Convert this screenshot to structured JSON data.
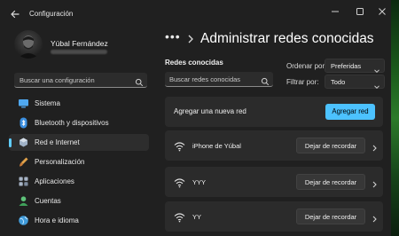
{
  "window": {
    "title": "Configuración"
  },
  "user": {
    "name": "Yúbal Fernández"
  },
  "sidebar": {
    "search_placeholder": "Buscar una configuración",
    "items": [
      {
        "label": "Sistema",
        "icon": "monitor-icon",
        "color": "#4fa8f0"
      },
      {
        "label": "Bluetooth y dispositivos",
        "icon": "bluetooth-icon",
        "color": "#4fa8f0"
      },
      {
        "label": "Red e Internet",
        "icon": "network-icon",
        "color": "#cfd8e3"
      },
      {
        "label": "Personalización",
        "icon": "brush-icon",
        "color": "#e0a24a"
      },
      {
        "label": "Aplicaciones",
        "icon": "apps-icon",
        "color": "#a7b4c6"
      },
      {
        "label": "Cuentas",
        "icon": "person-icon",
        "color": "#5ec27a"
      },
      {
        "label": "Hora e idioma",
        "icon": "globe-icon",
        "color": "#3f9ad8"
      }
    ],
    "active_index": 2,
    "accent": "#60cdff"
  },
  "main": {
    "breadcrumb_more": "•••",
    "title": "Administrar redes conocidas",
    "section_label": "Redes conocidas",
    "search_placeholder": "Buscar redes conocidas",
    "sort_label": "Ordenar por:",
    "sort_value": "Preferidas",
    "filter_label": "Filtrar por:",
    "filter_value": "Todo",
    "add_network_label": "Agregar una nueva red",
    "add_button": "Agregar red",
    "forget_button": "Dejar de recordar",
    "networks": [
      {
        "name": "iPhone de Yúbal"
      },
      {
        "name": "YYY"
      },
      {
        "name": "YY"
      }
    ],
    "accent_button_color": "#4cc2ff"
  }
}
